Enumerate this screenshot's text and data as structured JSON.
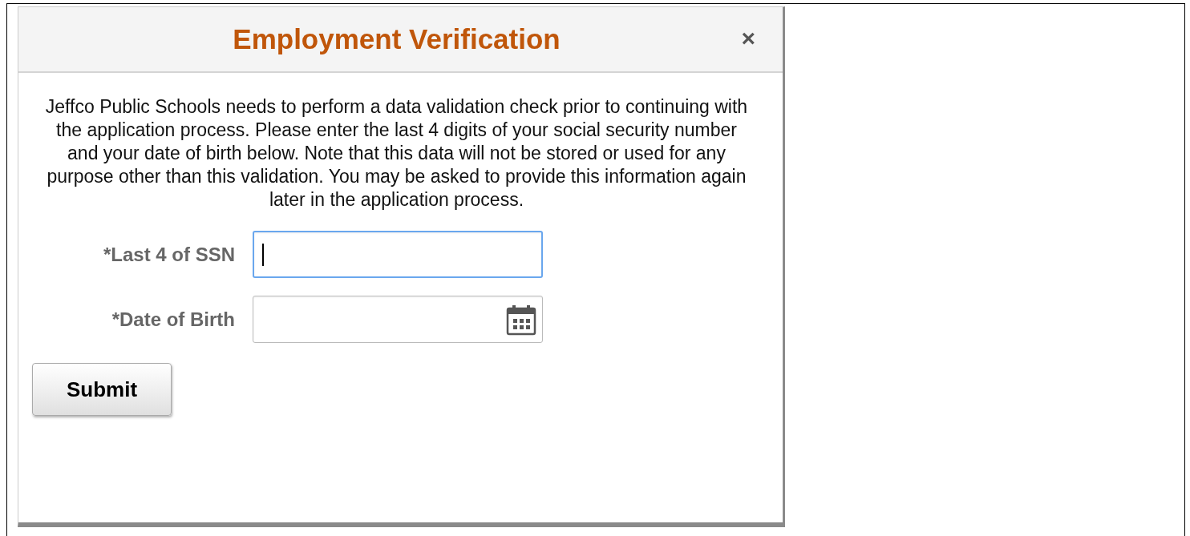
{
  "dialog": {
    "title": "Employment Verification",
    "close": "×",
    "message": "Jeffco Public Schools needs to perform a data validation check prior to continuing with the application process. Please enter the last 4 digits of your social security number and your date of birth below. Note that this data will not be stored or used for any purpose other than this validation. You may be asked to provide this information again later in the application process.",
    "fields": [
      {
        "label": "*Last 4 of SSN",
        "kind": "text",
        "focused": true
      },
      {
        "label": "*Date of Birth",
        "kind": "date",
        "focused": false
      }
    ],
    "button": "Submit"
  }
}
